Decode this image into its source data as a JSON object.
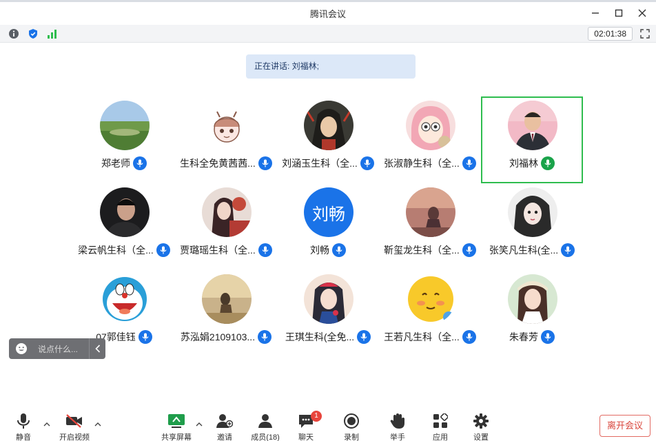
{
  "window": {
    "title": "腾讯会议"
  },
  "infobar": {
    "timer": "02:01:38"
  },
  "speaking": {
    "text": "正在讲话: 刘福林;"
  },
  "participants": [
    {
      "name": "郑老师",
      "mic": "blue",
      "avatar": "landscape"
    },
    {
      "name": "生科全免黄茜茜...",
      "mic": "blue",
      "avatar": "cartoon-girl"
    },
    {
      "name": "刘涵玉生科（全...",
      "mic": "blue",
      "avatar": "anime-dark"
    },
    {
      "name": "张淑静生科（全...",
      "mic": "blue",
      "avatar": "anime-pink"
    },
    {
      "name": "刘福林",
      "mic": "green",
      "avatar": "man-suit",
      "active": true
    },
    {
      "name": "梁云帆生科（全...",
      "mic": "blue",
      "avatar": "dark-portrait"
    },
    {
      "name": "贾璐瑶生科（全...",
      "mic": "blue",
      "avatar": "woman-red"
    },
    {
      "name": "刘畅",
      "mic": "blue",
      "avatar": "text",
      "avatar_text": "刘畅"
    },
    {
      "name": "靳玺龙生科（全...",
      "mic": "blue",
      "avatar": "sunset"
    },
    {
      "name": "张笑凡生科(全...",
      "mic": "blue",
      "avatar": "anime-bw"
    },
    {
      "name": "07郭佳钰",
      "mic": "blue",
      "avatar": "doraemon"
    },
    {
      "name": "苏泓娟2109103...",
      "mic": "blue",
      "avatar": "field-girl"
    },
    {
      "name": "王琪生科(全免...",
      "mic": "blue",
      "avatar": "snow-white"
    },
    {
      "name": "王若凡生科（全...",
      "mic": "blue",
      "avatar": "emoji"
    },
    {
      "name": "朱春芳",
      "mic": "blue",
      "avatar": "woman-hat"
    }
  ],
  "chat": {
    "placeholder": "说点什么..."
  },
  "toolbar": {
    "mute": "静音",
    "video": "开启视频",
    "share": "共享屏幕",
    "invite": "邀请",
    "members": "成员(18)",
    "chat": "聊天",
    "chat_badge": "1",
    "record": "录制",
    "raise_hand": "举手",
    "apps": "应用",
    "settings": "设置",
    "leave": "离开会议"
  },
  "colors": {
    "accent": "#1a73e8",
    "active_border": "#2ebd4e",
    "leave": "#d9453b"
  }
}
